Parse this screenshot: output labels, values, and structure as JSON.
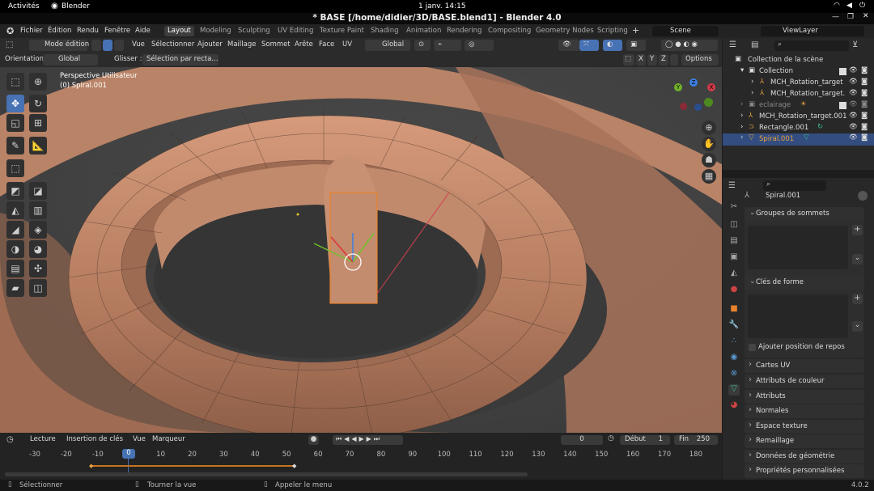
{
  "gnome": {
    "activities": "Activités",
    "app": "Blender",
    "clock": "1 janv.  14:15"
  },
  "window": {
    "title": "* BASE [/home/didier/3D/BASE.blend1] - Blender 4.0"
  },
  "menu": {
    "items": [
      "Fichier",
      "Édition",
      "Rendu",
      "Fenêtre",
      "Aide"
    ]
  },
  "workspaces": [
    "Layout",
    "Modeling",
    "Sculpting",
    "UV Editing",
    "Texture Paint",
    "Shading",
    "Animation",
    "Rendering",
    "Compositing",
    "Geometry Nodes",
    "Scripting"
  ],
  "top_right": {
    "scene": "Scene",
    "viewlayer": "ViewLayer"
  },
  "viewport_header": {
    "mode": "Mode édition",
    "menus": [
      "Vue",
      "Sélectionner",
      "Ajouter",
      "Maillage",
      "Sommet",
      "Arête",
      "Face",
      "UV"
    ],
    "transform": "Global",
    "orientation_label": "Orientation:",
    "orientation_value": "Global",
    "drag_label": "Glisser :",
    "drag_value": "Sélection par recta...",
    "options": "Options",
    "axes": [
      "X",
      "Y",
      "Z"
    ]
  },
  "viewport": {
    "view_name": "Perspective Utilisateur",
    "object": "(0) Spiral.001"
  },
  "gizmo": {
    "x": "X",
    "y": "Y",
    "z": "Z"
  },
  "outliner": {
    "root": "Collection de la scène",
    "rows": [
      {
        "name": "Collection"
      },
      {
        "name": "MCH_Rotation_target"
      },
      {
        "name": "MCH_Rotation_target."
      },
      {
        "name": "eclairage"
      },
      {
        "name": "MCH_Rotation_target.001"
      },
      {
        "name": "Rectangle.001"
      },
      {
        "name": "Spiral.001"
      }
    ]
  },
  "properties": {
    "object": "Spiral.001",
    "vertex_groups": "Groupes de sommets",
    "shape_keys": "Clés de forme",
    "add_rest": "Ajouter position de repos",
    "sections": [
      "Cartes UV",
      "Attributs de couleur",
      "Attributs",
      "Normales",
      "Espace texture",
      "Remaillage",
      "Données de géométrie",
      "Propriétés personnalisées"
    ]
  },
  "timeline": {
    "menus": [
      "Lecture",
      "Insertion de clés",
      "Vue",
      "Marqueur"
    ],
    "current_frame": "0",
    "start_label": "Début",
    "start": "1",
    "end_label": "Fin",
    "end": "250",
    "ticks": [
      "-30",
      "-20",
      "-10",
      "0",
      "10",
      "20",
      "30",
      "40",
      "50",
      "60",
      "70",
      "80",
      "90",
      "100",
      "110",
      "120",
      "130",
      "140",
      "150",
      "160",
      "170",
      "180"
    ]
  },
  "status": {
    "select": "Sélectionner",
    "rotate": "Tourner la vue",
    "menu": "Appeler le menu",
    "version": "4.0.2"
  },
  "colors": {
    "accent": "#4772b3",
    "mesh": "#c08668",
    "selected": "#e8822c",
    "active_row": "#334d80"
  }
}
